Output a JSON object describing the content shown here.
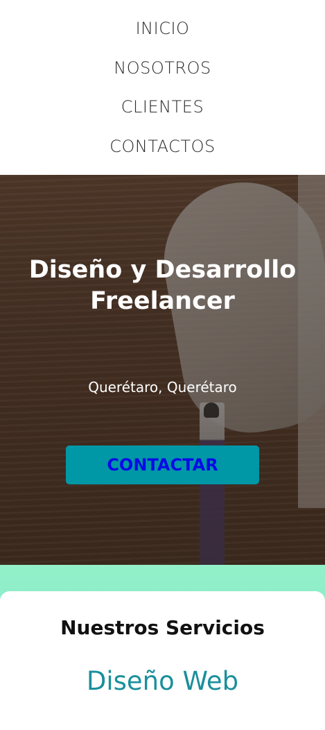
{
  "nav": {
    "items": [
      {
        "label": "INICIO"
      },
      {
        "label": "NOSOTROS"
      },
      {
        "label": "CLIENTES"
      },
      {
        "label": "CONTACTOS"
      }
    ]
  },
  "hero": {
    "title_line1": "Diseño y Desarrollo",
    "title_line2": "Freelancer",
    "location": "Querétaro, Querétaro",
    "cta_label": "CONTACTAR"
  },
  "services": {
    "title": "Nuestros Servicios",
    "items": [
      {
        "label": "Diseño Web"
      }
    ]
  },
  "colors": {
    "accent": "#0097a7",
    "cta_text": "#0a0ae6",
    "service_text": "#1a8f9c",
    "band": "#8eeecb"
  }
}
